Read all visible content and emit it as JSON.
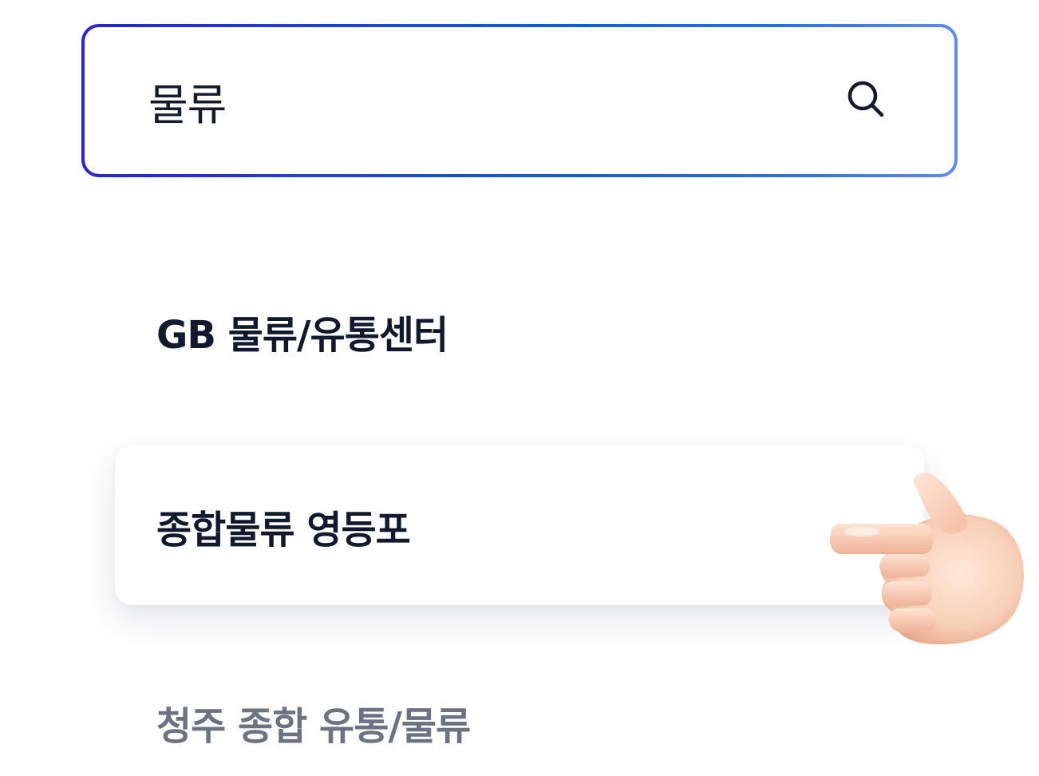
{
  "search": {
    "value": "물류",
    "icon": "search-icon",
    "border_gradient": [
      "#2a22d8",
      "#0f5ed8",
      "#5e8bf6"
    ]
  },
  "results": [
    {
      "label": "GB 물류/유통센터",
      "state": "normal"
    },
    {
      "label": "종합물류 영등포",
      "state": "highlighted"
    },
    {
      "label": "청주 종합 유통/물류",
      "state": "dimmed"
    }
  ],
  "pointer": {
    "icon": "pointing-hand-icon"
  },
  "colors": {
    "text_primary": "#10192d",
    "text_dimmed": "#6b7383",
    "background": "#ffffff"
  }
}
